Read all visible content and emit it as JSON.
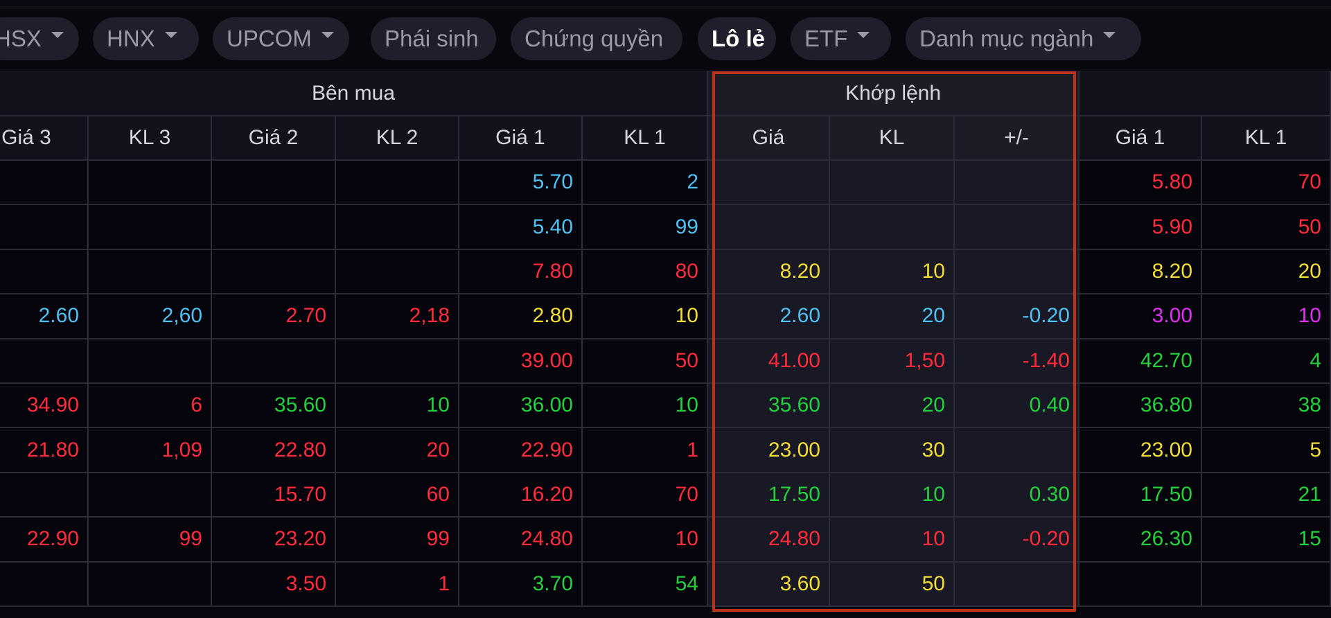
{
  "tabs": [
    {
      "label": "HSX",
      "dropdown": true,
      "active": false
    },
    {
      "label": "HNX",
      "dropdown": true,
      "active": false
    },
    {
      "label": "UPCOM",
      "dropdown": true,
      "active": false
    },
    {
      "label": "Phái sinh",
      "dropdown": false,
      "active": false
    },
    {
      "label": "Chứng quyền",
      "dropdown": false,
      "active": false
    },
    {
      "label": "Lô lẻ",
      "dropdown": false,
      "active": true
    },
    {
      "label": "ETF",
      "dropdown": true,
      "active": false
    },
    {
      "label": "Danh mục ngành",
      "dropdown": true,
      "active": false
    }
  ],
  "groups": {
    "buy": "Bên mua",
    "match": "Khớp lệnh"
  },
  "columns": [
    "Giá 3",
    "KL 3",
    "Giá 2",
    "KL 2",
    "Giá 1",
    "KL 1",
    "Giá",
    "KL",
    "+/-",
    "Giá 1",
    "KL 1"
  ],
  "colors": {
    "blue": "#4fc1f0",
    "red": "#ff2b3a",
    "yellow": "#f2dd35",
    "green": "#24d03c",
    "purple": "#e12ff0",
    "highlight_border": "#b8321c"
  },
  "rows": [
    [
      [
        "",
        ""
      ],
      [
        "",
        ""
      ],
      [
        "",
        ""
      ],
      [
        "",
        ""
      ],
      [
        "5.70",
        "blue"
      ],
      [
        "2",
        "blue"
      ],
      [
        "",
        ""
      ],
      [
        "",
        ""
      ],
      [
        "",
        ""
      ],
      [
        "5.80",
        "red"
      ],
      [
        "70",
        "red"
      ]
    ],
    [
      [
        "",
        ""
      ],
      [
        "",
        ""
      ],
      [
        "",
        ""
      ],
      [
        "",
        ""
      ],
      [
        "5.40",
        "blue"
      ],
      [
        "99",
        "blue"
      ],
      [
        "",
        ""
      ],
      [
        "",
        ""
      ],
      [
        "",
        ""
      ],
      [
        "5.90",
        "red"
      ],
      [
        "50",
        "red"
      ]
    ],
    [
      [
        "",
        ""
      ],
      [
        "",
        ""
      ],
      [
        "",
        ""
      ],
      [
        "",
        ""
      ],
      [
        "7.80",
        "red"
      ],
      [
        "80",
        "red"
      ],
      [
        "8.20",
        "yellow"
      ],
      [
        "10",
        "yellow"
      ],
      [
        "",
        ""
      ],
      [
        "8.20",
        "yellow"
      ],
      [
        "20",
        "yellow"
      ]
    ],
    [
      [
        "2.60",
        "blue"
      ],
      [
        "2,60",
        "blue"
      ],
      [
        "2.70",
        "red"
      ],
      [
        "2,18",
        "red"
      ],
      [
        "2.80",
        "yellow"
      ],
      [
        "10",
        "yellow"
      ],
      [
        "2.60",
        "blue"
      ],
      [
        "20",
        "blue"
      ],
      [
        "-0.20",
        "blue"
      ],
      [
        "3.00",
        "purple"
      ],
      [
        "10",
        "purple"
      ]
    ],
    [
      [
        "",
        ""
      ],
      [
        "",
        ""
      ],
      [
        "",
        ""
      ],
      [
        "",
        ""
      ],
      [
        "39.00",
        "red"
      ],
      [
        "50",
        "red"
      ],
      [
        "41.00",
        "red"
      ],
      [
        "1,50",
        "red"
      ],
      [
        "-1.40",
        "red"
      ],
      [
        "42.70",
        "green"
      ],
      [
        "4",
        "green"
      ]
    ],
    [
      [
        "34.90",
        "red"
      ],
      [
        "6",
        "red"
      ],
      [
        "35.60",
        "green"
      ],
      [
        "10",
        "green"
      ],
      [
        "36.00",
        "green"
      ],
      [
        "10",
        "green"
      ],
      [
        "35.60",
        "green"
      ],
      [
        "20",
        "green"
      ],
      [
        "0.40",
        "green"
      ],
      [
        "36.80",
        "green"
      ],
      [
        "38",
        "green"
      ]
    ],
    [
      [
        "21.80",
        "red"
      ],
      [
        "1,09",
        "red"
      ],
      [
        "22.80",
        "red"
      ],
      [
        "20",
        "red"
      ],
      [
        "22.90",
        "red"
      ],
      [
        "1",
        "red"
      ],
      [
        "23.00",
        "yellow"
      ],
      [
        "30",
        "yellow"
      ],
      [
        "",
        ""
      ],
      [
        "23.00",
        "yellow"
      ],
      [
        "5",
        "yellow"
      ]
    ],
    [
      [
        "",
        ""
      ],
      [
        "",
        ""
      ],
      [
        "15.70",
        "red"
      ],
      [
        "60",
        "red"
      ],
      [
        "16.20",
        "red"
      ],
      [
        "70",
        "red"
      ],
      [
        "17.50",
        "green"
      ],
      [
        "10",
        "green"
      ],
      [
        "0.30",
        "green"
      ],
      [
        "17.50",
        "green"
      ],
      [
        "21",
        "green"
      ]
    ],
    [
      [
        "22.90",
        "red"
      ],
      [
        "99",
        "red"
      ],
      [
        "23.20",
        "red"
      ],
      [
        "99",
        "red"
      ],
      [
        "24.80",
        "red"
      ],
      [
        "10",
        "red"
      ],
      [
        "24.80",
        "red"
      ],
      [
        "10",
        "red"
      ],
      [
        "-0.20",
        "red"
      ],
      [
        "26.30",
        "green"
      ],
      [
        "15",
        "green"
      ]
    ],
    [
      [
        "",
        ""
      ],
      [
        "",
        ""
      ],
      [
        "3.50",
        "red"
      ],
      [
        "1",
        "red"
      ],
      [
        "3.70",
        "green"
      ],
      [
        "54",
        "green"
      ],
      [
        "3.60",
        "yellow"
      ],
      [
        "50",
        "yellow"
      ],
      [
        "",
        ""
      ],
      [
        "",
        ""
      ],
      [
        "",
        ""
      ]
    ]
  ]
}
